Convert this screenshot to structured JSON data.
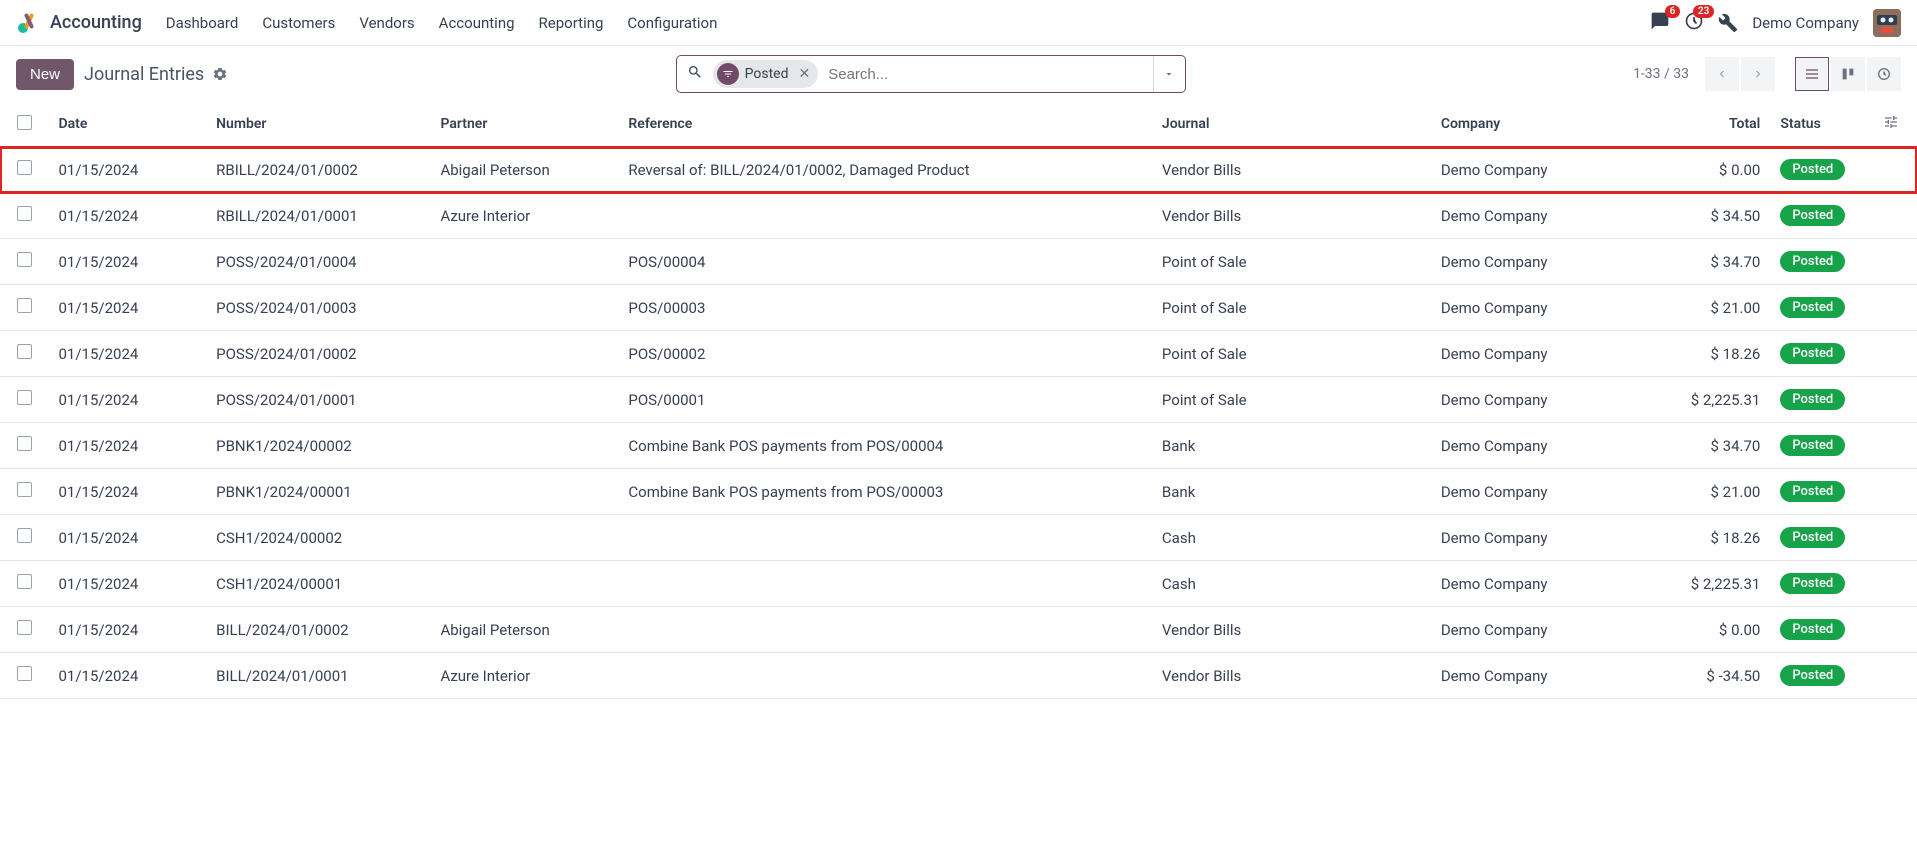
{
  "topnav": {
    "app_name": "Accounting",
    "items": [
      "Dashboard",
      "Customers",
      "Vendors",
      "Accounting",
      "Reporting",
      "Configuration"
    ],
    "msg_badge": "6",
    "activity_badge": "23",
    "company": "Demo Company"
  },
  "controlbar": {
    "new_label": "New",
    "breadcrumb": "Journal Entries",
    "filter_chip": "Posted",
    "search_placeholder": "Search...",
    "pager": "1-33 / 33"
  },
  "columns": {
    "date": "Date",
    "number": "Number",
    "partner": "Partner",
    "reference": "Reference",
    "journal": "Journal",
    "company": "Company",
    "total": "Total",
    "status": "Status"
  },
  "rows": [
    {
      "date": "01/15/2024",
      "number": "RBILL/2024/01/0002",
      "partner": "Abigail Peterson",
      "reference": "Reversal of: BILL/2024/01/0002, Damaged Product",
      "journal": "Vendor Bills",
      "company": "Demo Company",
      "total": "$ 0.00",
      "status": "Posted",
      "highlight": true
    },
    {
      "date": "01/15/2024",
      "number": "RBILL/2024/01/0001",
      "partner": "Azure Interior",
      "reference": "",
      "journal": "Vendor Bills",
      "company": "Demo Company",
      "total": "$ 34.50",
      "status": "Posted"
    },
    {
      "date": "01/15/2024",
      "number": "POSS/2024/01/0004",
      "partner": "",
      "reference": "POS/00004",
      "journal": "Point of Sale",
      "company": "Demo Company",
      "total": "$ 34.70",
      "status": "Posted"
    },
    {
      "date": "01/15/2024",
      "number": "POSS/2024/01/0003",
      "partner": "",
      "reference": "POS/00003",
      "journal": "Point of Sale",
      "company": "Demo Company",
      "total": "$ 21.00",
      "status": "Posted"
    },
    {
      "date": "01/15/2024",
      "number": "POSS/2024/01/0002",
      "partner": "",
      "reference": "POS/00002",
      "journal": "Point of Sale",
      "company": "Demo Company",
      "total": "$ 18.26",
      "status": "Posted"
    },
    {
      "date": "01/15/2024",
      "number": "POSS/2024/01/0001",
      "partner": "",
      "reference": "POS/00001",
      "journal": "Point of Sale",
      "company": "Demo Company",
      "total": "$ 2,225.31",
      "status": "Posted"
    },
    {
      "date": "01/15/2024",
      "number": "PBNK1/2024/00002",
      "partner": "",
      "reference": "Combine Bank POS payments from POS/00004",
      "journal": "Bank",
      "company": "Demo Company",
      "total": "$ 34.70",
      "status": "Posted"
    },
    {
      "date": "01/15/2024",
      "number": "PBNK1/2024/00001",
      "partner": "",
      "reference": "Combine Bank POS payments from POS/00003",
      "journal": "Bank",
      "company": "Demo Company",
      "total": "$ 21.00",
      "status": "Posted"
    },
    {
      "date": "01/15/2024",
      "number": "CSH1/2024/00002",
      "partner": "",
      "reference": "",
      "journal": "Cash",
      "company": "Demo Company",
      "total": "$ 18.26",
      "status": "Posted"
    },
    {
      "date": "01/15/2024",
      "number": "CSH1/2024/00001",
      "partner": "",
      "reference": "",
      "journal": "Cash",
      "company": "Demo Company",
      "total": "$ 2,225.31",
      "status": "Posted"
    },
    {
      "date": "01/15/2024",
      "number": "BILL/2024/01/0002",
      "partner": "Abigail Peterson",
      "reference": "",
      "journal": "Vendor Bills",
      "company": "Demo Company",
      "total": "$ 0.00",
      "status": "Posted"
    },
    {
      "date": "01/15/2024",
      "number": "BILL/2024/01/0001",
      "partner": "Azure Interior",
      "reference": "",
      "journal": "Vendor Bills",
      "company": "Demo Company",
      "total": "$ -34.50",
      "status": "Posted"
    }
  ]
}
